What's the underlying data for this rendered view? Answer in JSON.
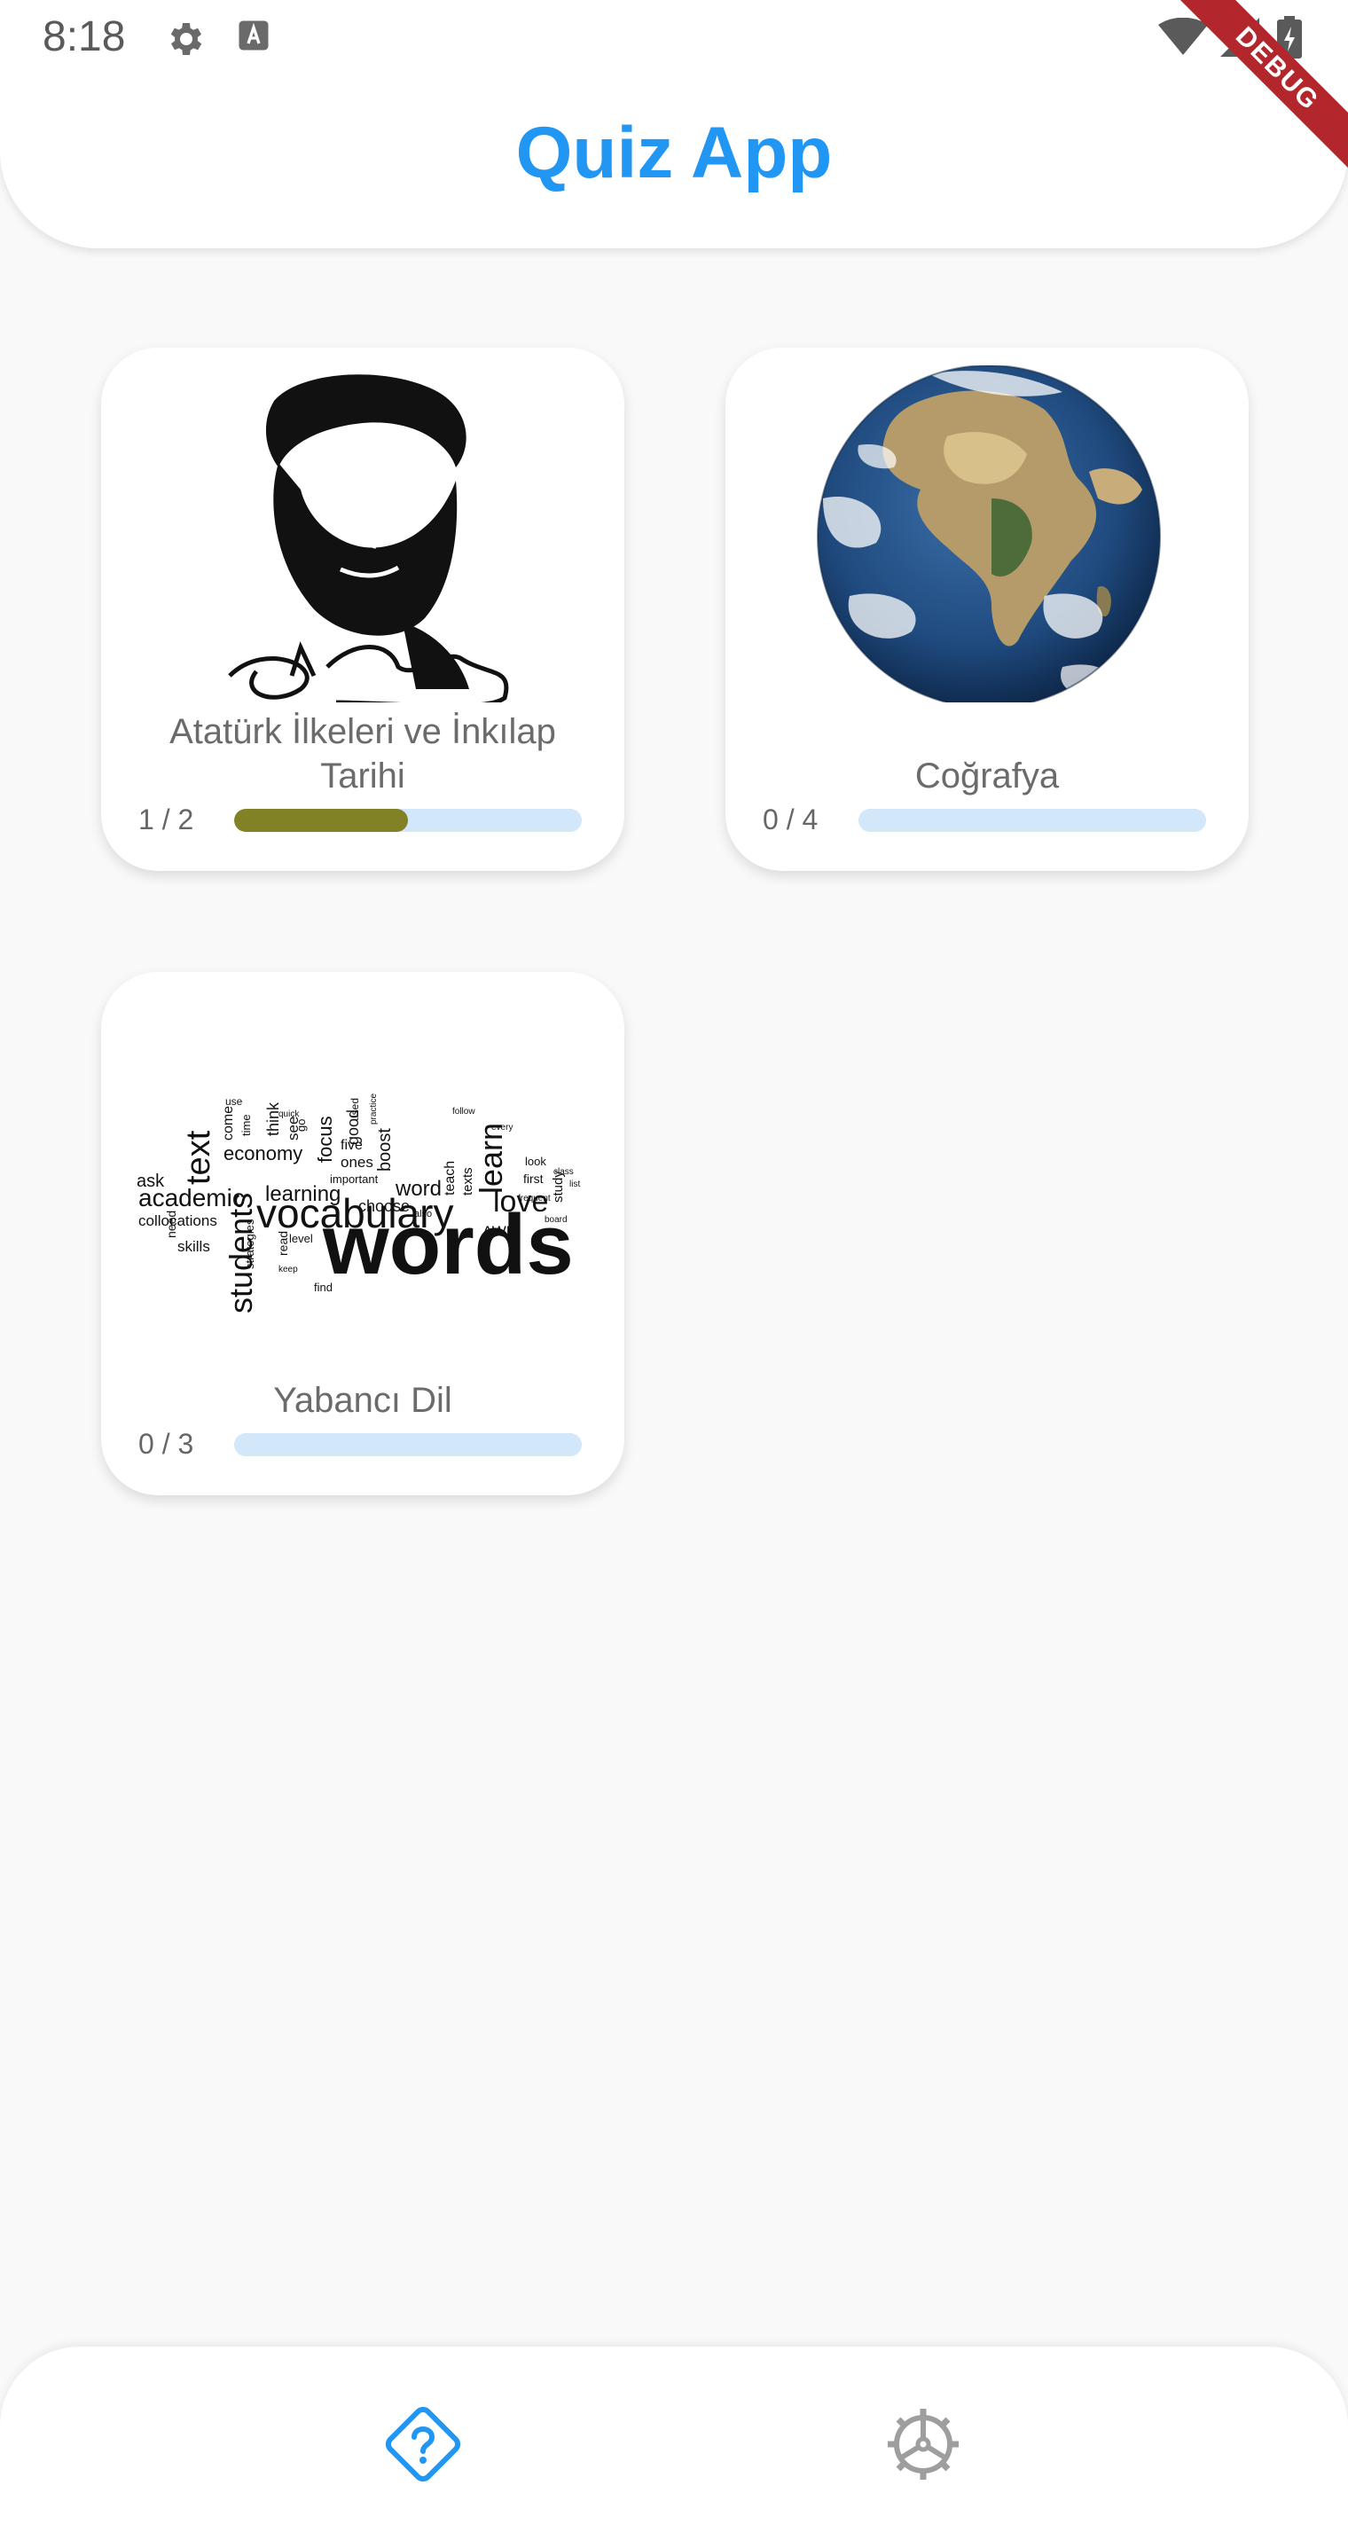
{
  "status_bar": {
    "time": "8:18",
    "icons": [
      "gear-icon",
      "text-a-icon",
      "wifi-icon",
      "signal-icon",
      "battery-icon"
    ]
  },
  "debug_banner": "DEBUG",
  "header": {
    "title": "Quiz App",
    "title_color": "#2196f3"
  },
  "categories": [
    {
      "title": "Atatürk İlkeleri ve İnkılap Tarihi",
      "count": "1 / 2",
      "progress": 0.5,
      "image": "ataturk-portrait"
    },
    {
      "title": "Coğrafya",
      "count": "0 / 4",
      "progress": 0,
      "image": "earth-globe"
    },
    {
      "title": "Yabancı Dil",
      "count": "0 / 3",
      "progress": 0,
      "image": "vocabulary-word-cloud"
    }
  ],
  "word_cloud": {
    "big": "words",
    "medium": [
      "vocabulary",
      "students",
      "academic",
      "text",
      "learn",
      "love",
      "learning",
      "economy",
      "collocations",
      "focus",
      "word",
      "boost",
      "skills",
      "choose",
      "good",
      "AWL",
      "ask",
      "five",
      "ones",
      "important"
    ],
    "small": [
      "use",
      "think",
      "see",
      "come",
      "time",
      "need",
      "read",
      "level",
      "find",
      "keep",
      "teach",
      "texts",
      "first",
      "look",
      "study",
      "also",
      "strategies",
      "every",
      "follow",
      "frequent",
      "board",
      "quick",
      "go",
      "used",
      "practice",
      "list",
      "class"
    ]
  },
  "colors": {
    "progress_track": "#d3e7fa",
    "progress_fill": "#818126",
    "nav_active": "#2196f3",
    "nav_inactive": "#9e9e9e"
  },
  "bottom_nav": [
    {
      "icon": "quiz-icon",
      "active": true
    },
    {
      "icon": "settings-icon",
      "active": false
    }
  ]
}
